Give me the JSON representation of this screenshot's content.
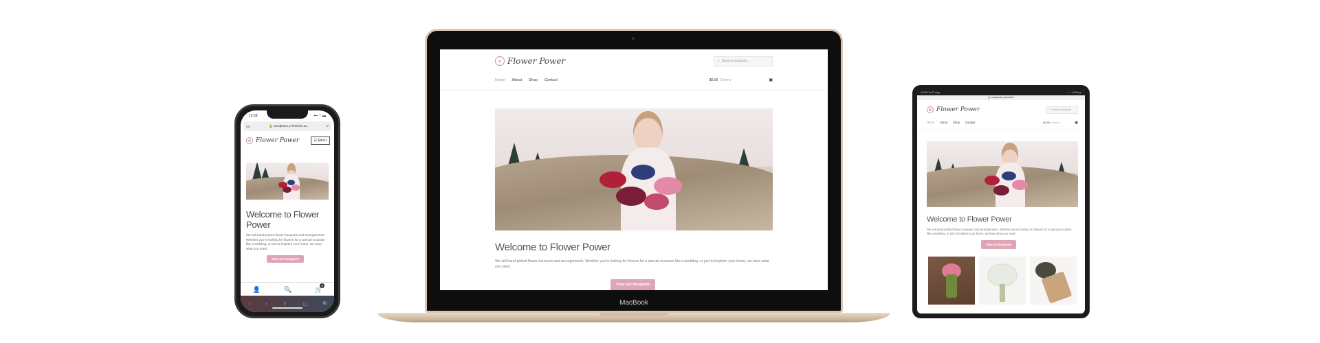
{
  "phone": {
    "status": {
      "time": "12:58",
      "signal": "▪▪▪ ◠ ▬"
    },
    "url": {
      "prefix": "AA",
      "text": "🔒 wordpress.y-feminine.au",
      "reload": "↻"
    },
    "site": {
      "logo_text": "Flower Power",
      "menu_label": "☰ Menu",
      "heading": "Welcome to Flower Power",
      "intro": "We sell hand-picked flower bouquets and arrangements. Whether you're looking for flowers for a special occasion like a wedding, or just to brighten your home, we have what you need.",
      "button": "View our bouquets"
    },
    "tabbar": {
      "account": "👤",
      "search": "🔍",
      "cart": "🛒",
      "cart_count": "0"
    },
    "browser": [
      "‹",
      "›",
      "⇪",
      "▢",
      "⧉"
    ]
  },
  "laptop": {
    "brand": "MacBook",
    "site": {
      "logo_text": "Flower Power",
      "search_placeholder": "Search products…",
      "nav": [
        "Home",
        "About",
        "Shop",
        "Contact"
      ],
      "cart_total": "$0.00",
      "cart_items": "0 items",
      "heading": "Welcome to Flower Power",
      "intro": "We sell hand-picked flower bouquets and arrangements. Whether you're looking for flowers for a special occasion like a wedding, or just to brighten your home, we have what you need.",
      "button": "View our bouquets"
    }
  },
  "tablet": {
    "status": {
      "time": "10:36   Thu 27 Aug",
      "icons": "▪ ◠ 100% ▬"
    },
    "url": "🔒 wordpress.y-feminine",
    "site": {
      "logo_text": "Flower Power",
      "search_placeholder": "Search products",
      "nav": [
        "Home",
        "About",
        "Shop",
        "Contact"
      ],
      "cart_total": "$0.00",
      "cart_items": "0 items",
      "heading": "Welcome to Flower Power",
      "intro": "We sell hand-picked flower bouquets and arrangements. Whether you're looking for flowers for a special occasion like a wedding, or just to brighten your home, we have what you need.",
      "button": "View our bouquets"
    }
  },
  "colors": {
    "accent_pink": "#e0a5b5",
    "text_dark": "#4b4b4b",
    "gold": "#d8c6b2"
  },
  "icons": {
    "search": "search-icon",
    "basket": "basket-icon",
    "menu": "menu-icon",
    "lock": "lock-icon"
  }
}
